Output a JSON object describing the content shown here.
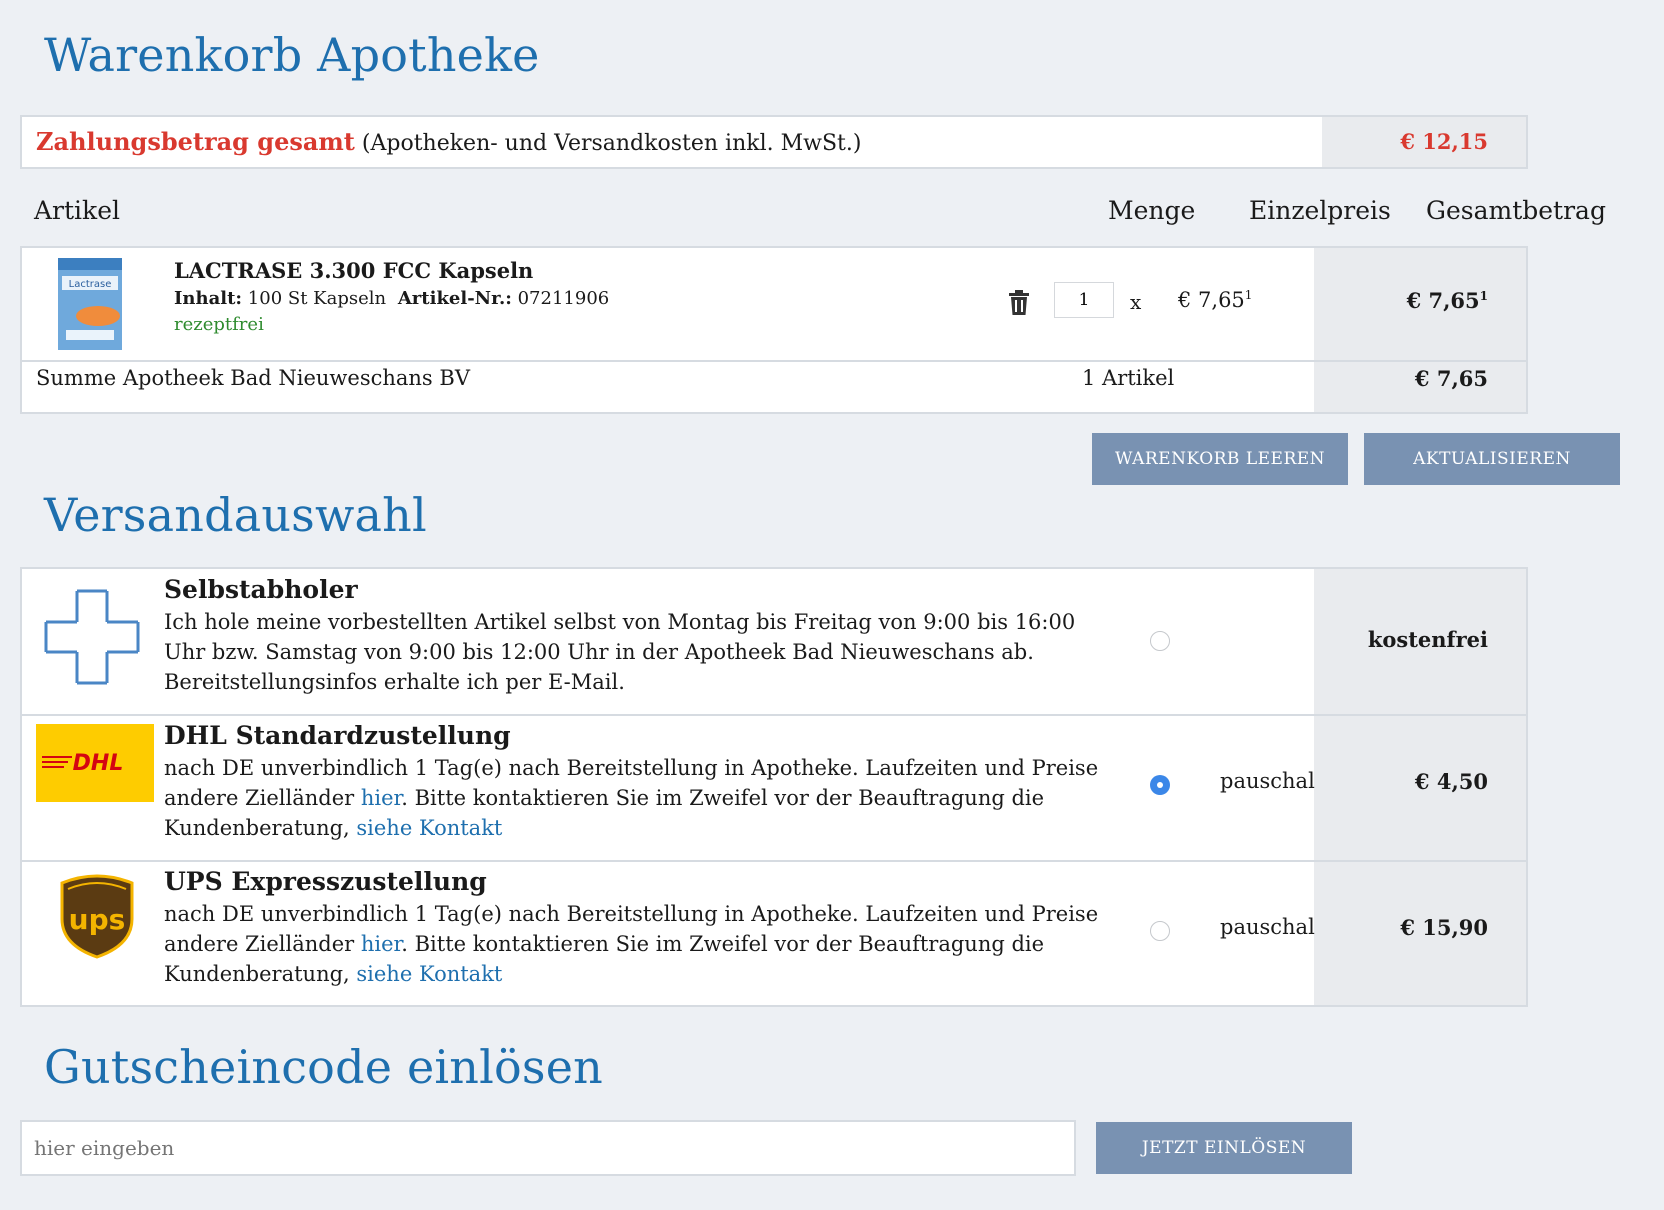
{
  "page_title": "Warenkorb Apotheke",
  "summary": {
    "label_strong": "Zahlungsbetrag gesamt",
    "label_note": "(Apotheken- und Versandkosten inkl. MwSt.)",
    "amount": "€ 12,15"
  },
  "table": {
    "headers": {
      "article": "Artikel",
      "qty": "Menge",
      "unit": "Einzelpreis",
      "total": "Gesamtbetrag"
    }
  },
  "item": {
    "name": "LACTRASE 3.300 FCC Kapseln",
    "content_label": "Inhalt:",
    "content_value": "100 St Kapseln",
    "artnr_label": "Artikel-Nr.:",
    "artnr_value": "07211906",
    "status": "rezeptfrei",
    "quantity": "1",
    "times": "x",
    "unit_price": "€ 7,65",
    "unit_sup": "1",
    "total": "€ 7,65",
    "total_sup": "1",
    "image_label": "Lactrase"
  },
  "subtotal": {
    "label": "Summe Apotheek Bad Nieuweschans BV",
    "count": "1 Artikel",
    "amount": "€ 7,65"
  },
  "buttons": {
    "clear": "WARENKORB LEEREN",
    "update": "AKTUALISIEREN",
    "redeem": "JETZT EINLÖSEN"
  },
  "shipping_title": "Versandauswahl",
  "shipping": [
    {
      "title": "Selbstabholer",
      "desc": "Ich hole meine vorbestellten Artikel selbst von Montag bis Freitag von 9:00 bis 16:00 Uhr bzw. Samstag von 9:00 bis 12:00 Uhr in der Apotheek Bad Nieuweschans ab. Bereitstellungsinfos erhalte ich per E-Mail.",
      "price": "kostenfrei",
      "selected": false
    },
    {
      "title": "DHL Standardzustellung",
      "desc_a": "nach DE unverbindlich 1 Tag(e) nach Bereitstellung in Apotheke. Laufzeiten und Preise andere Zielländer ",
      "link1": "hier",
      "desc_b": ". Bitte kontaktieren Sie im Zweifel vor der Beauftragung die Kundenberatung, ",
      "link2": "siehe Kontakt",
      "mode": "pauschal",
      "price": "€ 4,50",
      "logo": "DHL",
      "selected": true
    },
    {
      "title": "UPS Expresszustellung",
      "desc_a": "nach DE unverbindlich 1 Tag(e) nach Bereitstellung in Apotheke. Laufzeiten und Preise andere Zielländer ",
      "link1": "hier",
      "desc_b": ". Bitte kontaktieren Sie im Zweifel vor der Beauftragung die Kundenberatung, ",
      "link2": "siehe Kontakt",
      "mode": "pauschal",
      "price": "€ 15,90",
      "logo": "ups",
      "selected": false
    }
  ],
  "voucher": {
    "title": "Gutscheincode einlösen",
    "placeholder": "hier eingeben"
  },
  "colors": {
    "heading": "#1e6fae",
    "accent_red": "#d9392f",
    "button": "#7992b2",
    "radio_selected": "#3b87e8"
  }
}
